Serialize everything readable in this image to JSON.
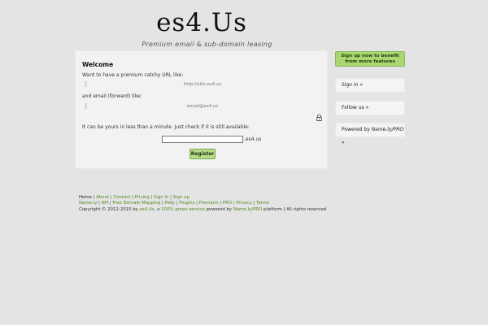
{
  "header": {
    "logo": "es4.Us",
    "tagline": "Premium email & sub-domain leasing"
  },
  "main": {
    "welcome": "Welcome",
    "url_prompt": "Want to have a premium catchy URL like:",
    "url_example": "http://site.es4.us",
    "email_prompt": "and email (forward) like:",
    "email_example": "email@es4.us",
    "availability_prompt": "It can be yours in less than a minute. Just check if it is still available:",
    "input_value": "",
    "domain_suffix": ".es4.us",
    "register_label": "Register",
    "lock_icon": "lock-icon"
  },
  "sidebar": {
    "cta": "Sign up now to benefit from more features",
    "sign_in": "Sign in »",
    "follow": "Follow us »",
    "powered_prefix": "Powered by ",
    "powered_brand": "Name.ly/PRO",
    "powered_suffix": " »"
  },
  "footer": {
    "row1": [
      "Home",
      "About",
      "Contact",
      "Pricing",
      "Sign in",
      "Sign up"
    ],
    "row2": [
      "Name.ly",
      "API",
      "Free Domain Mapping",
      "Help",
      "Plugins",
      "Premium",
      "PRO",
      "Privacy",
      "Terms"
    ],
    "copyright_prefix": "Copyright © 2012-2015 by ",
    "copyright_site": "es4.Us",
    "copyright_mid1": ", a ",
    "copyright_green": "100% green service",
    "copyright_mid2": " powered by ",
    "copyright_platform": "Name.ly/PRO",
    "copyright_suffix": " platform | All rights reserved"
  },
  "colors": {
    "background": "#e4e4e4",
    "link_green": "#4f8a1f",
    "button_green": "#b6dc88",
    "cta_green": "#a9d873"
  }
}
